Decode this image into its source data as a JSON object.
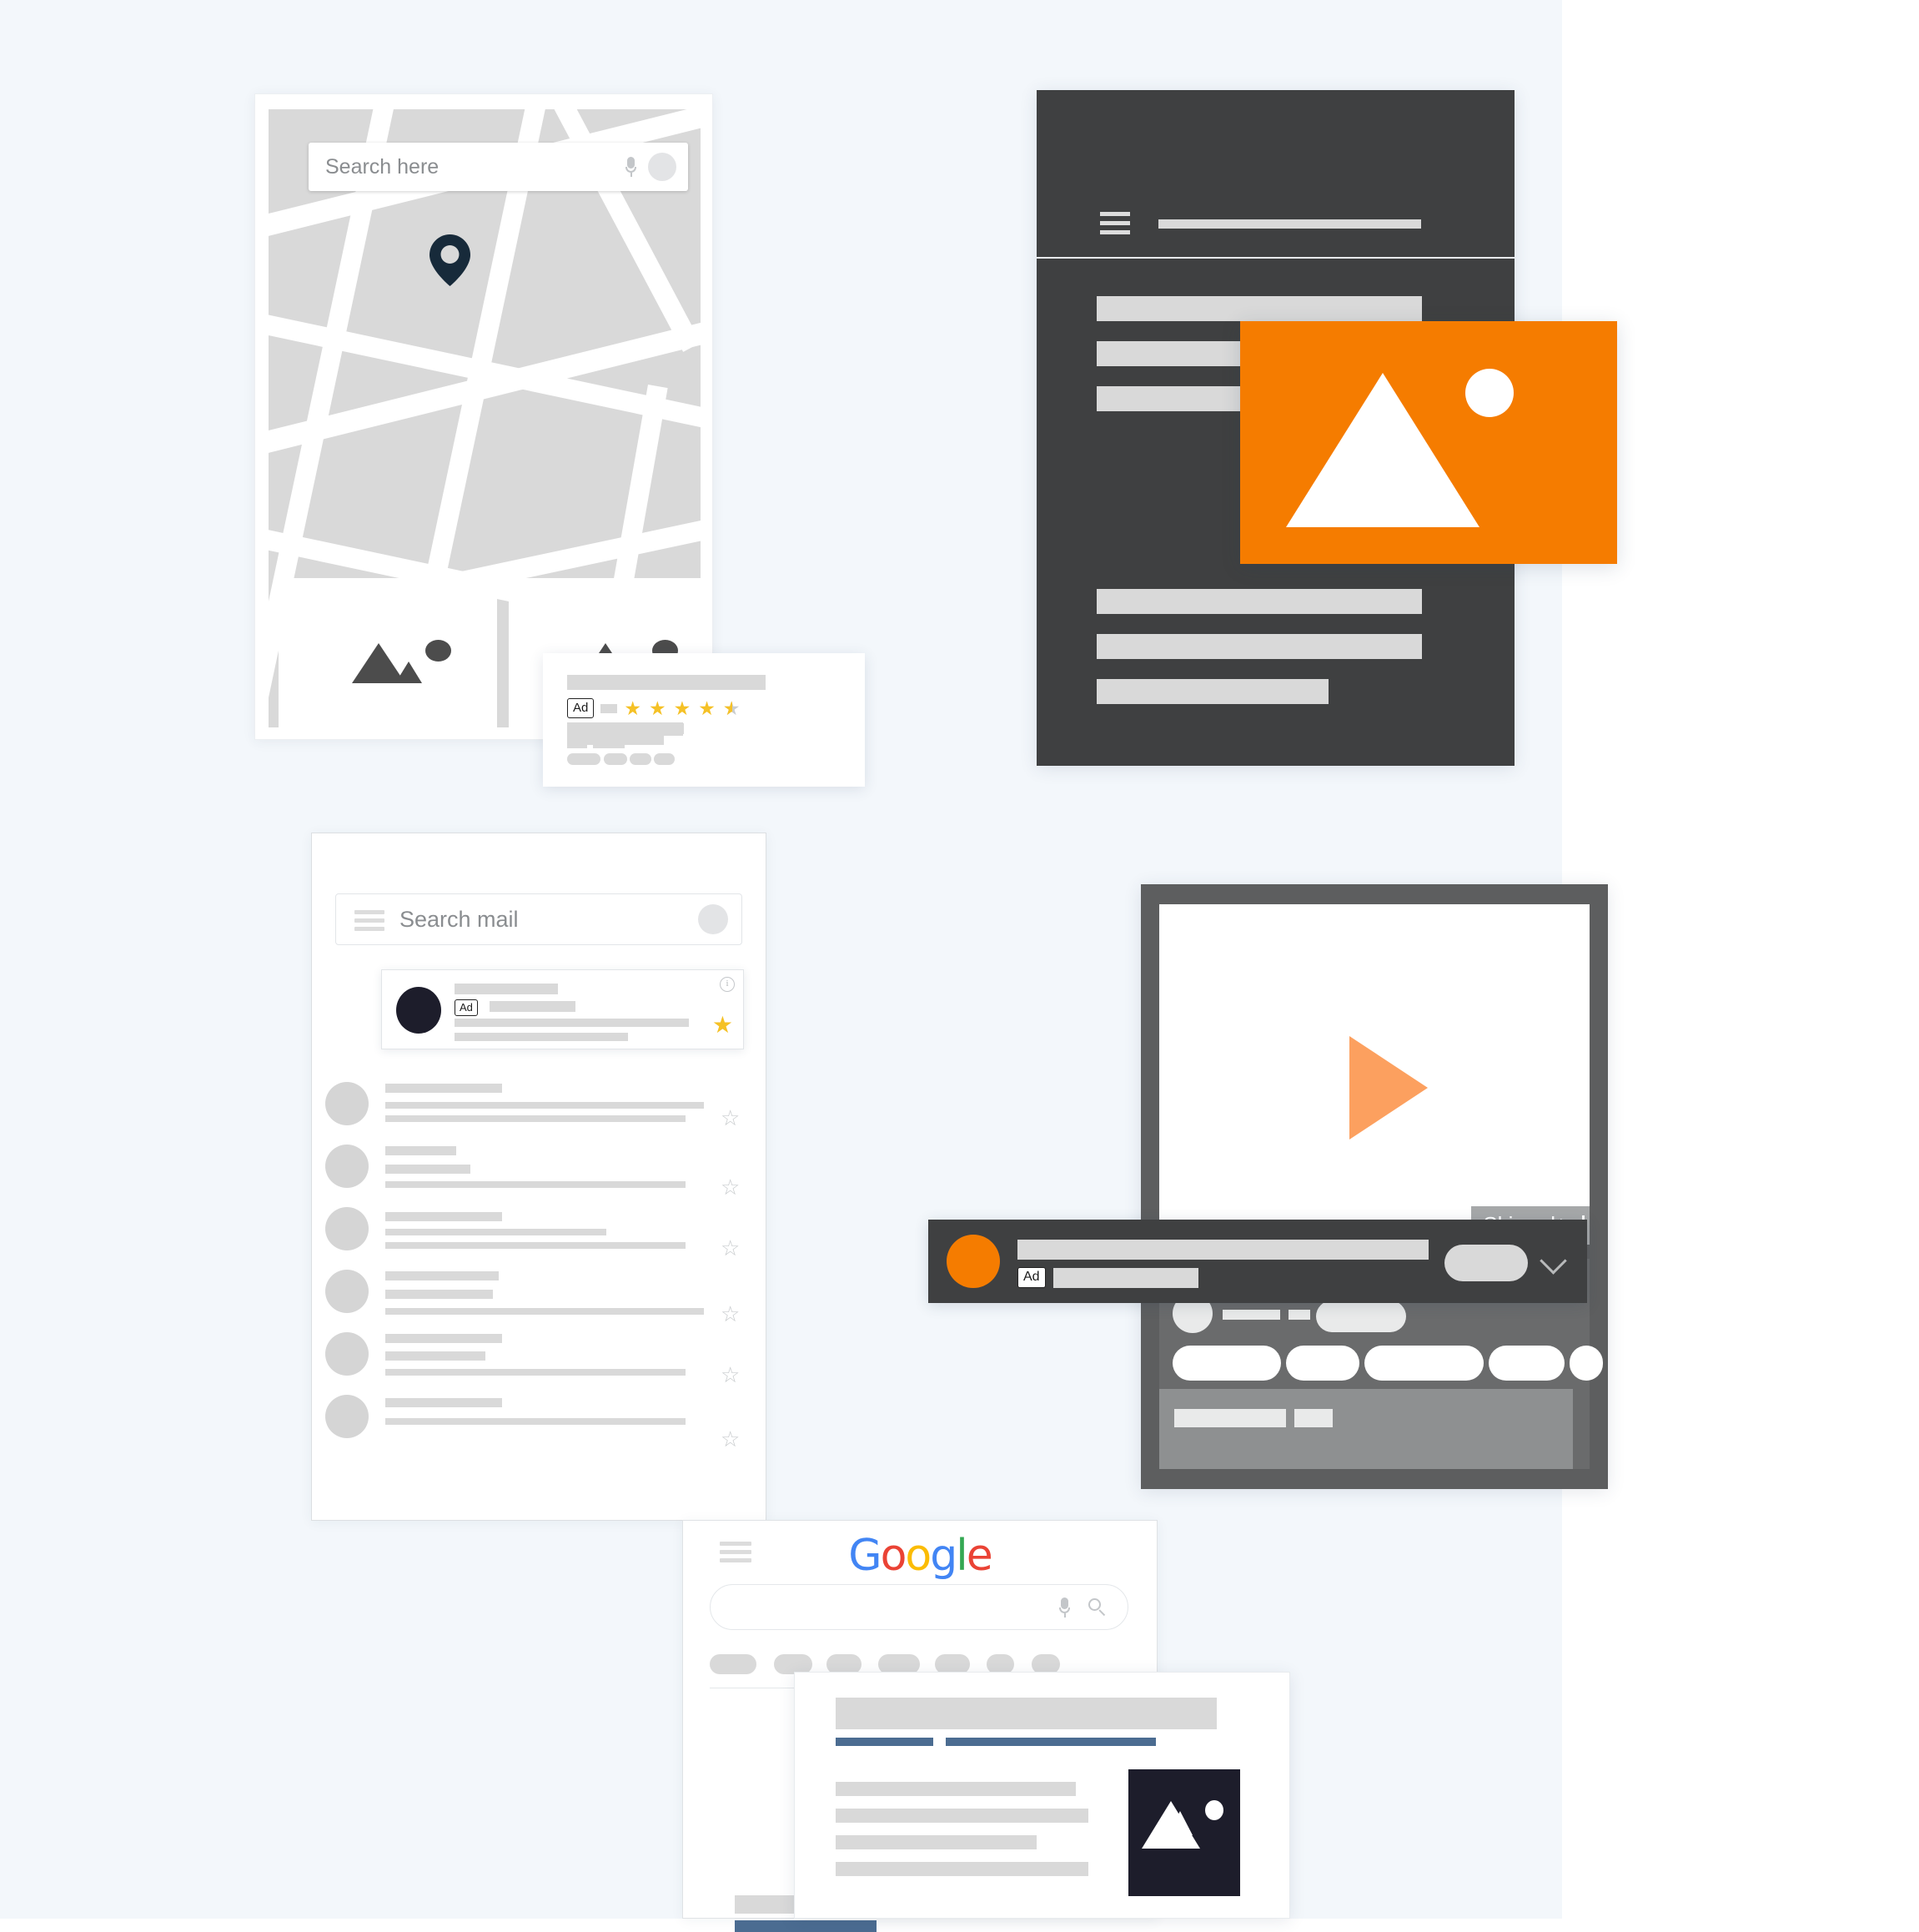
{
  "meta": {
    "background_left": "#f3f7fb",
    "background_right": "#ffffff",
    "accent_orange": "#f57c00",
    "accent_orange_light": "#fca05f",
    "star_yellow": "#f5c126",
    "dark_panel": "#3f4041",
    "video_frame": "#5d5e5f",
    "serp_link_blue": "#4b6c91",
    "skeleton_gray": "#d9d9d9"
  },
  "map_panel": {
    "search": {
      "placeholder": "Search here",
      "value": ""
    },
    "mic_icon": "microphone-icon",
    "avatar_icon": "account-avatar",
    "pin_icon": "map-pin-icon",
    "photo_placeholder_icon": "image-placeholder-icon"
  },
  "map_ad_card": {
    "ad_label": "Ad",
    "rating": {
      "value": 4.5,
      "max": 5,
      "full_stars": 4,
      "half_stars": 1,
      "empty_stars": 0
    },
    "star_glyph": "★",
    "half_star_glyph": "★"
  },
  "dark_panel": {
    "menu_icon": "hamburger-menu-icon",
    "title_bar_placeholder": "",
    "banner": {
      "type": "display-ad",
      "image_icon": "image-placeholder-icon",
      "color": "#f57c00"
    },
    "paragraph_lines": 6
  },
  "mail_panel": {
    "menu_icon": "hamburger-menu-icon",
    "search": {
      "placeholder": "Search mail",
      "value": ""
    },
    "avatar_icon": "account-avatar",
    "ad_row": {
      "ad_label": "Ad",
      "info_icon": "info-icon",
      "info_glyph": "i",
      "star_icon": "star-filled-icon",
      "star_glyph": "★",
      "avatar_icon": "sender-avatar"
    },
    "rows": [
      {
        "star_glyph": "☆"
      },
      {
        "star_glyph": "☆"
      },
      {
        "star_glyph": "☆"
      },
      {
        "star_glyph": "☆"
      },
      {
        "star_glyph": "☆"
      },
      {
        "star_glyph": "☆"
      }
    ]
  },
  "video_panel": {
    "play_icon": "play-button-icon",
    "skip_ad": {
      "label": "Skip ad",
      "arrow_glyph": "▶"
    },
    "ad_overlay": {
      "ad_label": "Ad",
      "advertiser_avatar_icon": "advertiser-avatar",
      "cta_button_label": "",
      "expand_icon": "chevron-down-icon"
    }
  },
  "google_panel": {
    "menu_icon": "hamburger-menu-icon",
    "logo": {
      "text": "Google",
      "letters": [
        "G",
        "o",
        "o",
        "g",
        "l",
        "e"
      ],
      "colors": [
        "#4285F4",
        "#EA4335",
        "#FBBC05",
        "#4285F4",
        "#34A853",
        "#EA4335"
      ]
    },
    "search": {
      "placeholder": "",
      "value": ""
    },
    "mic_icon": "microphone-icon",
    "search_icon": "search-icon",
    "chips_count": 7
  },
  "serp_card": {
    "thumb_icon": "image-placeholder-icon",
    "link_lines": 2,
    "snippet_lines": 4
  }
}
